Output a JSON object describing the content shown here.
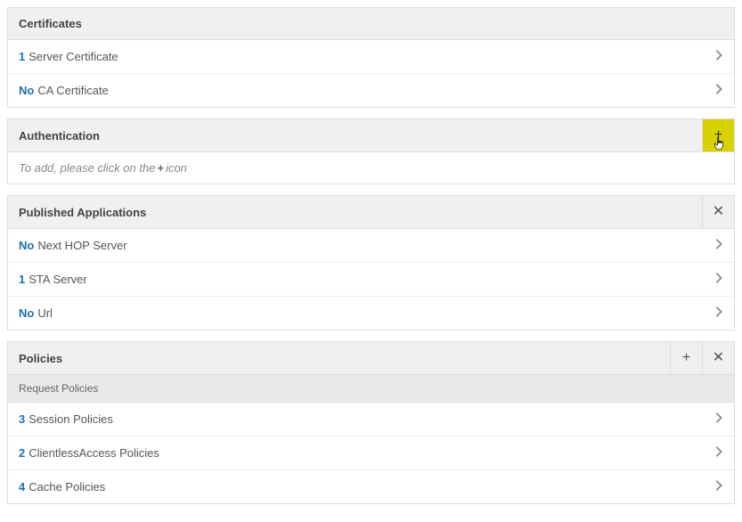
{
  "sections": {
    "certificates": {
      "title": "Certificates",
      "rows": [
        {
          "count": "1",
          "label": "Server Certificate"
        },
        {
          "count": "No",
          "label": "CA Certificate"
        }
      ]
    },
    "authentication": {
      "title": "Authentication",
      "hint_pre": "To add, please click on the ",
      "hint_plus": "+",
      "hint_post": " icon"
    },
    "published_apps": {
      "title": "Published Applications",
      "rows": [
        {
          "count": "No",
          "label": "Next HOP Server"
        },
        {
          "count": "1",
          "label": "STA Server"
        },
        {
          "count": "No",
          "label": "Url"
        }
      ]
    },
    "policies": {
      "title": "Policies",
      "subheader": "Request Policies",
      "rows": [
        {
          "count": "3",
          "label": "Session Policies"
        },
        {
          "count": "2",
          "label": "ClientlessAccess Policies"
        },
        {
          "count": "4",
          "label": "Cache Policies"
        }
      ]
    }
  }
}
